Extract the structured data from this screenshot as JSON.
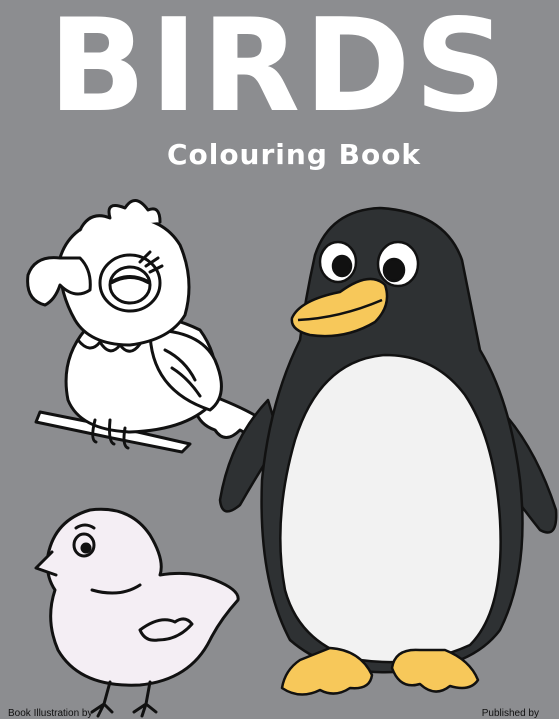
{
  "cover": {
    "title": "BIRDS",
    "subtitle": "Colouring Book",
    "credit_left": "Book Illustration by",
    "credit_right": "Published by"
  },
  "colors": {
    "background": "#8c8d90",
    "title_text": "#ffffff",
    "penguin_body": "#2e3133",
    "penguin_belly": "#f2f2f2",
    "penguin_beak": "#f7c85a",
    "chick_fill": "#f4eef4",
    "parrot_fill": "#ffffff",
    "outline": "#111111"
  },
  "illustrations": [
    "parrot",
    "penguin",
    "chick"
  ]
}
